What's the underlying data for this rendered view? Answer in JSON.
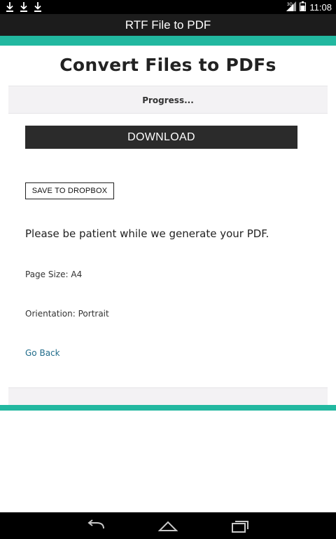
{
  "status_bar": {
    "time": "11:08",
    "signal_label": "3G",
    "icons": [
      "download-icon",
      "download-icon",
      "download-icon",
      "signal-icon",
      "battery-icon"
    ]
  },
  "app_bar": {
    "title": "RTF File to PDF"
  },
  "main": {
    "heading": "Convert Files to PDFs",
    "progress_text": "Progress...",
    "download_label": "DOWNLOAD",
    "dropbox_label": "SAVE TO DROPBOX",
    "patience_text": "Please be patient while we generate your PDF.",
    "page_size": "Page Size: A4",
    "orientation": "Orientation: Portrait",
    "go_back": "Go Back"
  },
  "nav_bar": {
    "icons": [
      "back-icon",
      "home-icon",
      "recents-icon"
    ]
  },
  "colors": {
    "accent": "#22b8a0",
    "app_bar": "#1c1c1c",
    "button": "#2b2b2b",
    "link": "#1f6b8a"
  }
}
